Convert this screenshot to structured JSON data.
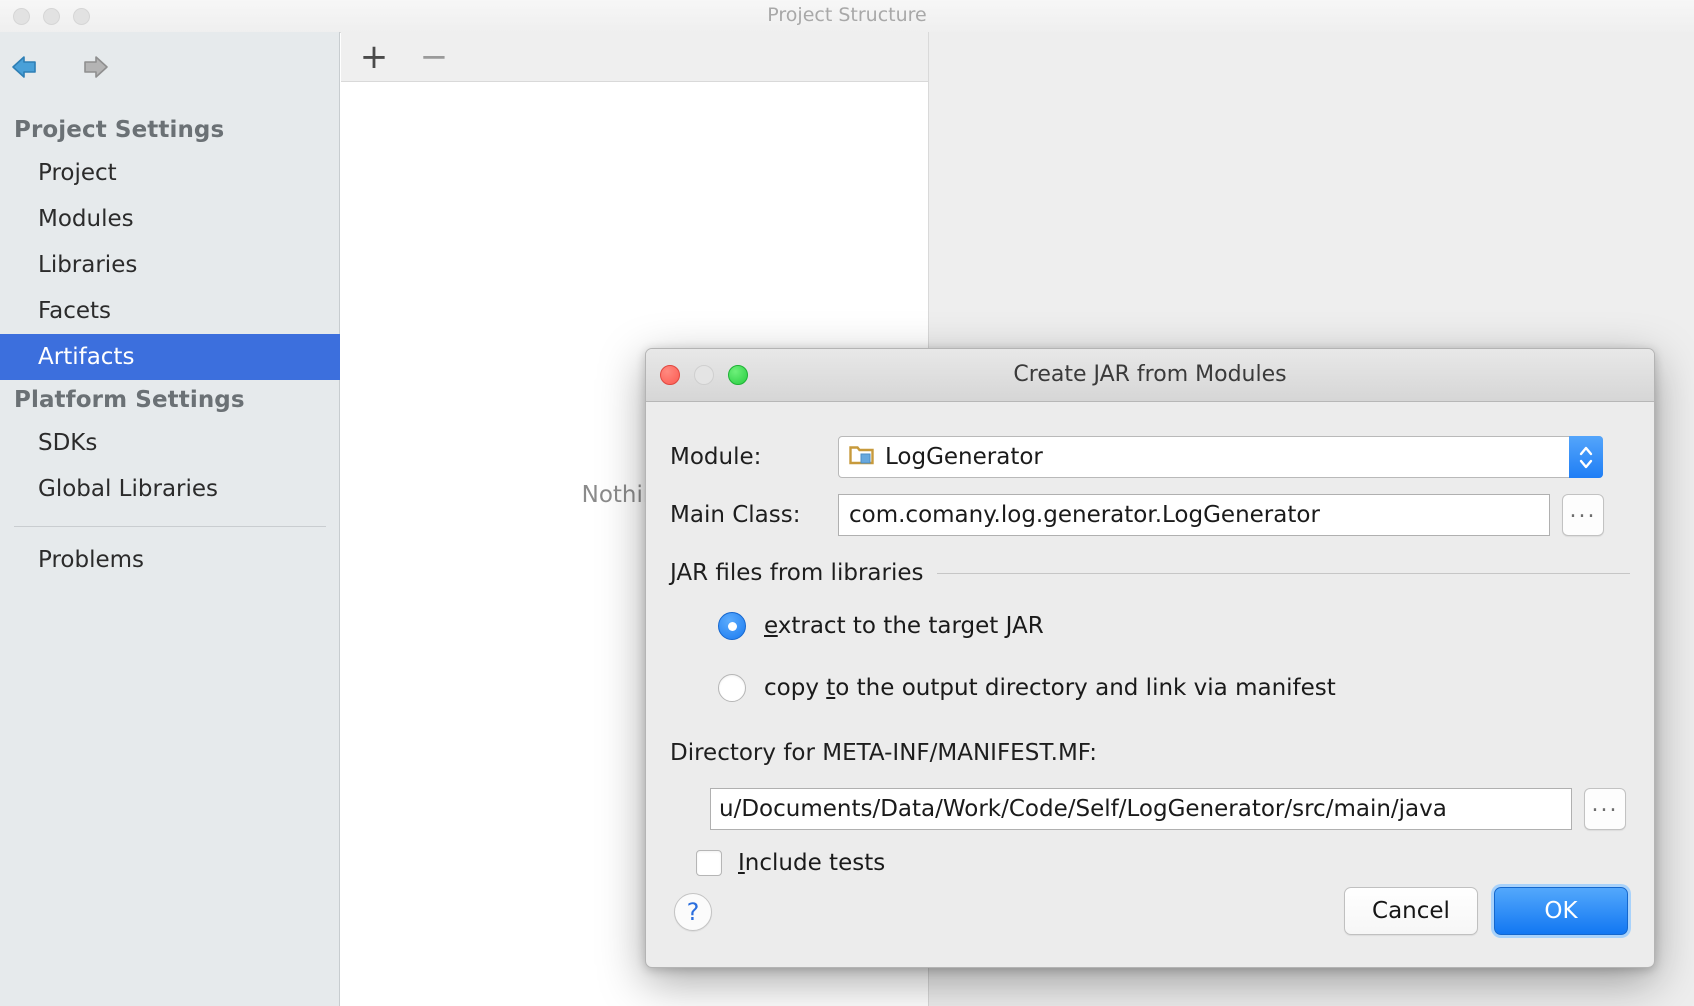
{
  "window": {
    "title": "Project Structure",
    "traffic_lights": [
      "close",
      "minimize",
      "zoom"
    ]
  },
  "sidebar": {
    "nav": {
      "back_icon": "arrow-left-icon",
      "forward_icon": "arrow-right-icon"
    },
    "groups": [
      {
        "title": "Project Settings",
        "items": [
          {
            "label": "Project",
            "selected": false
          },
          {
            "label": "Modules",
            "selected": false
          },
          {
            "label": "Libraries",
            "selected": false
          },
          {
            "label": "Facets",
            "selected": false
          },
          {
            "label": "Artifacts",
            "selected": true
          }
        ]
      },
      {
        "title": "Platform Settings",
        "items": [
          {
            "label": "SDKs",
            "selected": false
          },
          {
            "label": "Global Libraries",
            "selected": false
          }
        ]
      }
    ],
    "footer_items": [
      {
        "label": "Problems",
        "selected": false
      }
    ],
    "selected_color": "#3c6fdd"
  },
  "middle": {
    "toolbar": {
      "add_label": "+",
      "remove_label": "−"
    },
    "empty_text": "Nothing t"
  },
  "dialog": {
    "title": "Create JAR from Modules",
    "module": {
      "label": "Module:",
      "value": "LogGenerator",
      "icon": "module-folder-icon",
      "stepper_icon": "chevron-up-down-icon"
    },
    "main_class": {
      "label": "Main Class:",
      "value": "com.comany.log.generator.LogGenerator",
      "browse_label": "..."
    },
    "jar_group": {
      "label": "JAR files from libraries"
    },
    "radios": [
      {
        "id": "extract",
        "prefix": "",
        "mnemonic": "e",
        "suffix": "xtract to the target JAR",
        "selected": true
      },
      {
        "id": "copy",
        "prefix": "copy ",
        "mnemonic": "t",
        "suffix": "o the output directory and link via manifest",
        "selected": false
      }
    ],
    "directory": {
      "label": "Directory for META-INF/MANIFEST.MF:",
      "value": "u/Documents/Data/Work/Code/Self/LogGenerator/src/main/java",
      "browse_label": "..."
    },
    "include_tests": {
      "prefix": "",
      "mnemonic": "I",
      "suffix": "nclude tests",
      "checked": false
    },
    "footer": {
      "help_label": "?",
      "cancel_label": "Cancel",
      "ok_label": "OK"
    },
    "accent_color": "#1277f2"
  }
}
